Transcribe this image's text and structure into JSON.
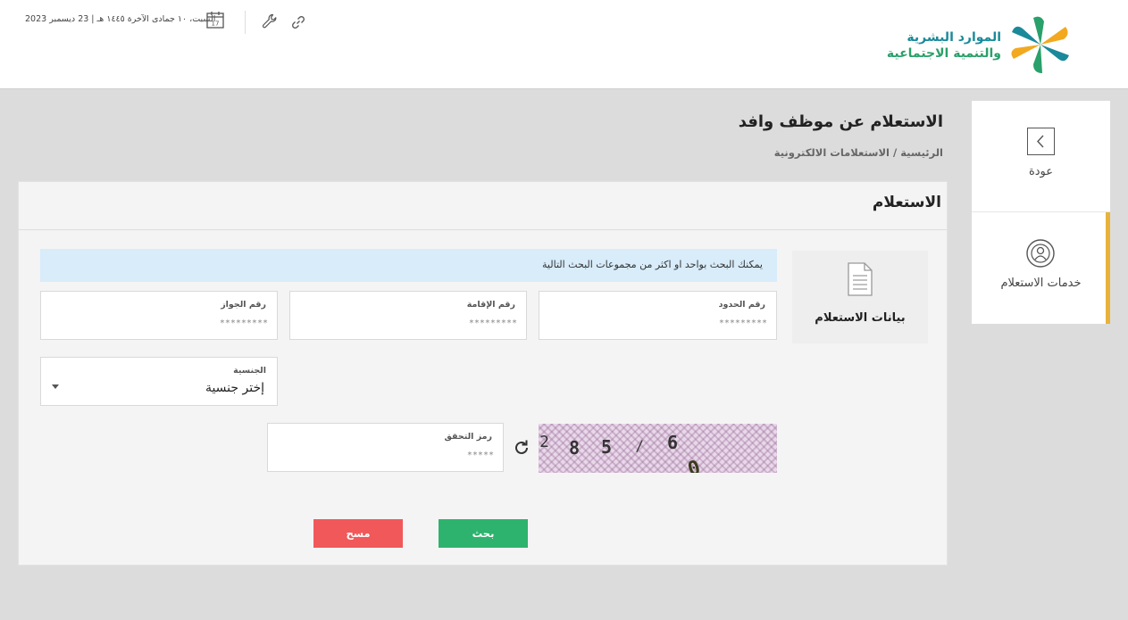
{
  "header": {
    "logo": {
      "line1": "الموارد البشرية",
      "line2": "والتنمية الاجتماعية"
    },
    "date_text": "السبت، ١٠ جمادى الآخرة ١٤٤٥ هـ | 23 ديسمبر 2023",
    "calendar_day": "17",
    "icons": [
      "calendar-icon",
      "wrench-icon",
      "link-icon"
    ]
  },
  "sidebar": {
    "back_label": "عودة",
    "services_label": "خدمات الاستعلام",
    "accent_color": "#e8b33a"
  },
  "page": {
    "title": "الاستعلام عن موظف وافد",
    "breadcrumb": "الرئيسية / الاستعلامات الالكترونية"
  },
  "panel": {
    "title": "الاستعلام",
    "nav_card_label": "بيانات الاستعلام",
    "info_text": "يمكنك البحث بواحد او اكثر من مجموعات البحث التالية",
    "fields": {
      "hudud": {
        "label": "رقم الحدود",
        "placeholder": "*********"
      },
      "iqama": {
        "label": "رقم الإقامة",
        "placeholder": "*********"
      },
      "passport": {
        "label": "رقم الجواز",
        "placeholder": "*********"
      },
      "nationality": {
        "label": "الجنسية",
        "value": "إختر جنسية"
      },
      "captcha": {
        "label": "رمز التحقق",
        "placeholder": "*****"
      }
    },
    "captcha_chars": [
      "2",
      "8",
      "5",
      "/",
      "6",
      "0"
    ],
    "buttons": {
      "search": "بحث",
      "clear": "مسح"
    },
    "colors": {
      "search": "#2db36d",
      "clear": "#f1585a",
      "info_bg": "#d8ecfa"
    }
  }
}
